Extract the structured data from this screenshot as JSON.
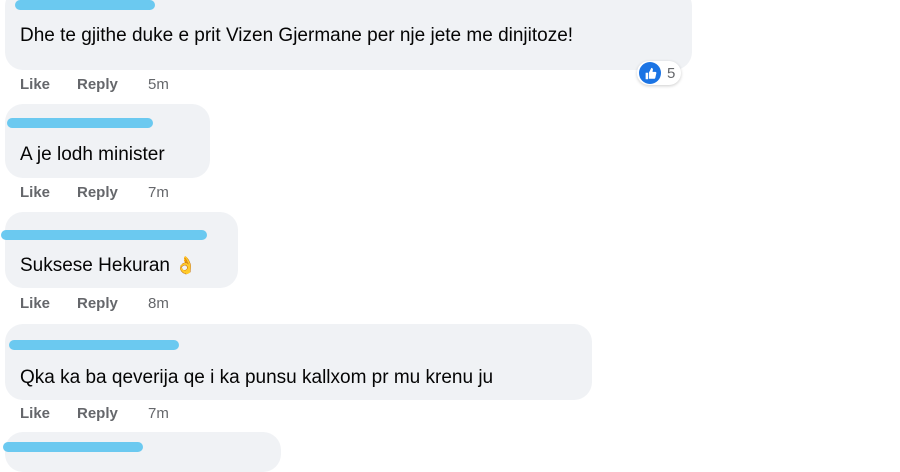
{
  "comments": [
    {
      "text": "Dhe te gjithe duke e prit Vizen Gjermane per nje jete me dinjitoze!",
      "like_label": "Like",
      "reply_label": "Reply",
      "time": "5m",
      "reaction": {
        "icon": "like-icon",
        "count": "5"
      }
    },
    {
      "text": "A je lodh minister",
      "like_label": "Like",
      "reply_label": "Reply",
      "time": "7m"
    },
    {
      "text": "Suksese Hekuran",
      "emoji": "👌",
      "like_label": "Like",
      "reply_label": "Reply",
      "time": "8m"
    },
    {
      "text": "Qka ka ba qeverija qe i ka punsu kallxom pr mu krenu ju",
      "like_label": "Like",
      "reply_label": "Reply",
      "time": "7m"
    }
  ],
  "colors": {
    "bubble": "#f0f2f5",
    "redaction": "#5cc4f0",
    "like_blue": "#1b74e4",
    "meta_gray": "#65676b"
  }
}
